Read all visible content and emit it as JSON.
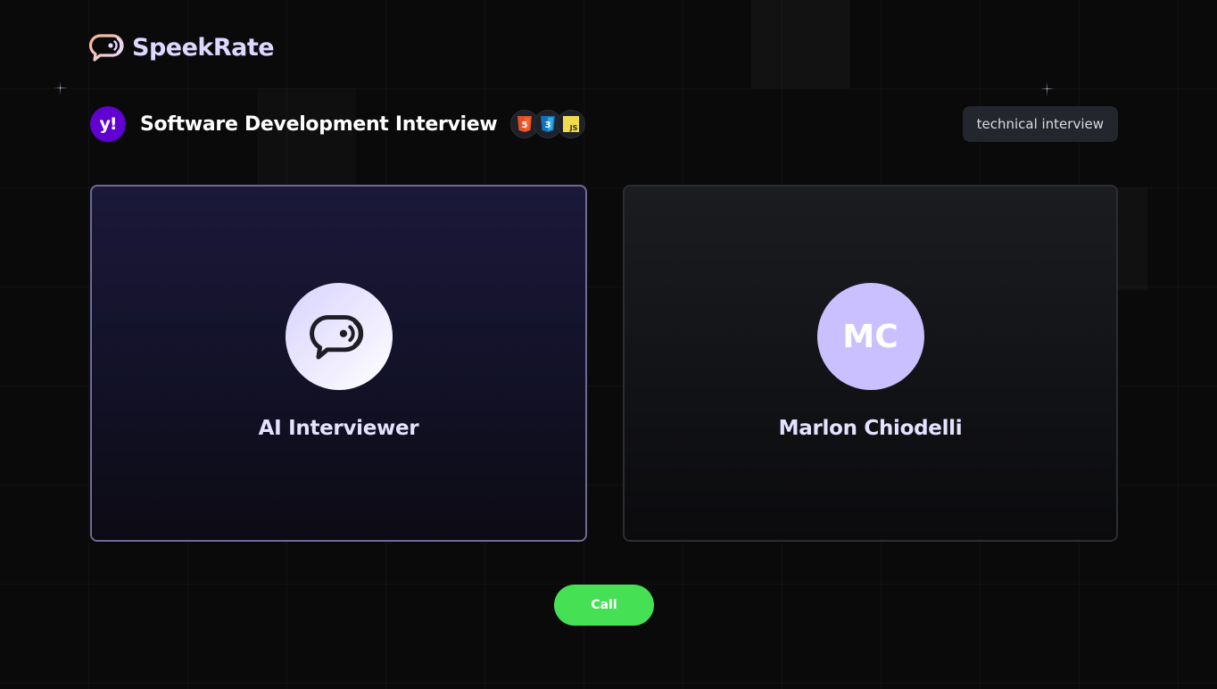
{
  "brand": {
    "name": "SpeekRate",
    "logo_icon": "chat-signal-icon",
    "colors": {
      "peach": "#f6b48a",
      "lavender": "#dcd8ff"
    }
  },
  "interview": {
    "company_logo_text": "y!",
    "company_logo_color": "#6001d2",
    "title": "Software Development Interview",
    "tech_stack": [
      {
        "name": "html5-icon",
        "label": "5",
        "color": "#e34f26"
      },
      {
        "name": "css3-icon",
        "label": "3",
        "color": "#1572b6"
      },
      {
        "name": "javascript-icon",
        "label": "JS",
        "color": "#f0db4f"
      }
    ],
    "tag": "technical interview"
  },
  "participants": {
    "ai": {
      "name": "AI Interviewer",
      "avatar_icon": "chat-signal-icon"
    },
    "user": {
      "name": "Marlon Chiodelli",
      "initials": "MC"
    }
  },
  "actions": {
    "call_label": "Call",
    "call_color": "#45e054"
  }
}
